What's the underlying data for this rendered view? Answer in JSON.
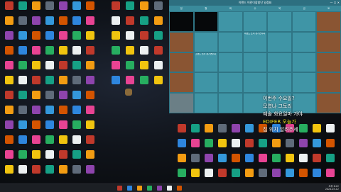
{
  "calendar": {
    "title": "이랜드 어린이합창단 일정표",
    "window_buttons": "— ☐ ✕",
    "days": [
      "일",
      "월",
      "화",
      "수",
      "목",
      "금",
      "토"
    ],
    "cells": [
      {
        "day": "",
        "event": "",
        "style": "black"
      },
      {
        "day": "",
        "event": "",
        "style": "black"
      },
      {
        "day": "",
        "event": "",
        "style": "normal"
      },
      {
        "day": "",
        "event": "",
        "style": "normal"
      },
      {
        "day": "",
        "event": "",
        "style": "normal"
      },
      {
        "day": "",
        "event": "",
        "style": "normal"
      },
      {
        "day": "",
        "event": "",
        "style": "brown"
      },
      {
        "day": "",
        "event": "",
        "style": "brown"
      },
      {
        "day": "",
        "event": "",
        "style": "normal"
      },
      {
        "day": "",
        "event": "",
        "style": "normal"
      },
      {
        "day": "",
        "event": "이랜드 소리 정기연주회",
        "style": "normal"
      },
      {
        "day": "",
        "event": "",
        "style": "normal"
      },
      {
        "day": "",
        "event": "",
        "style": "normal"
      },
      {
        "day": "",
        "event": "",
        "style": "brown"
      },
      {
        "day": "",
        "event": "",
        "style": "brown"
      },
      {
        "day": "",
        "event": "그랜드 소리 정기연주회",
        "style": "normal"
      },
      {
        "day": "",
        "event": "",
        "style": "normal"
      },
      {
        "day": "",
        "event": "",
        "style": "normal"
      },
      {
        "day": "",
        "event": "",
        "style": "normal"
      },
      {
        "day": "",
        "event": "",
        "style": "normal"
      },
      {
        "day": "",
        "event": "",
        "style": "brown"
      },
      {
        "day": "",
        "event": "",
        "style": "brown"
      },
      {
        "day": "",
        "event": "",
        "style": "normal"
      },
      {
        "day": "",
        "event": "",
        "style": "normal"
      },
      {
        "day": "",
        "event": "",
        "style": "normal"
      },
      {
        "day": "",
        "event": "",
        "style": "normal"
      },
      {
        "day": "",
        "event": "",
        "style": "normal"
      },
      {
        "day": "",
        "event": "",
        "style": "brown"
      },
      {
        "day": "",
        "event": "",
        "style": "grey"
      },
      {
        "day": "",
        "event": "",
        "style": "normal"
      },
      {
        "day": "",
        "event": "",
        "style": "normal"
      },
      {
        "day": "",
        "event": "",
        "style": "normal"
      },
      {
        "day": "",
        "event": "",
        "style": "normal"
      },
      {
        "day": "",
        "event": "",
        "style": "normal"
      },
      {
        "day": "",
        "event": "",
        "style": "brown"
      }
    ]
  },
  "overlay_lines": [
    {
      "text": "이번주 수요일?",
      "color": "white"
    },
    {
      "text": "모였냐 그토리",
      "color": "white"
    },
    {
      "text": "예술 화요일마 가야",
      "color": "white"
    },
    {
      "text": "EDIFER 오늘가",
      "color": "yellow"
    },
    {
      "text": "집 위치 알려주세",
      "color": "white"
    }
  ],
  "icon_colors": [
    "#c0392b",
    "#2e86de",
    "#f39c12",
    "#27ae60",
    "#8e44ad",
    "#ecf0f1",
    "#d35400",
    "#16a085",
    "#e84393",
    "#5f6b7a",
    "#f1c40f",
    "#3498db"
  ],
  "tray": {
    "time": "오후 6:22",
    "date": "2024-03-12"
  },
  "taskbar_icons": [
    "start-icon",
    "search-icon",
    "explorer-icon",
    "browser-icon",
    "chat-icon",
    "store-icon",
    "music-icon"
  ]
}
